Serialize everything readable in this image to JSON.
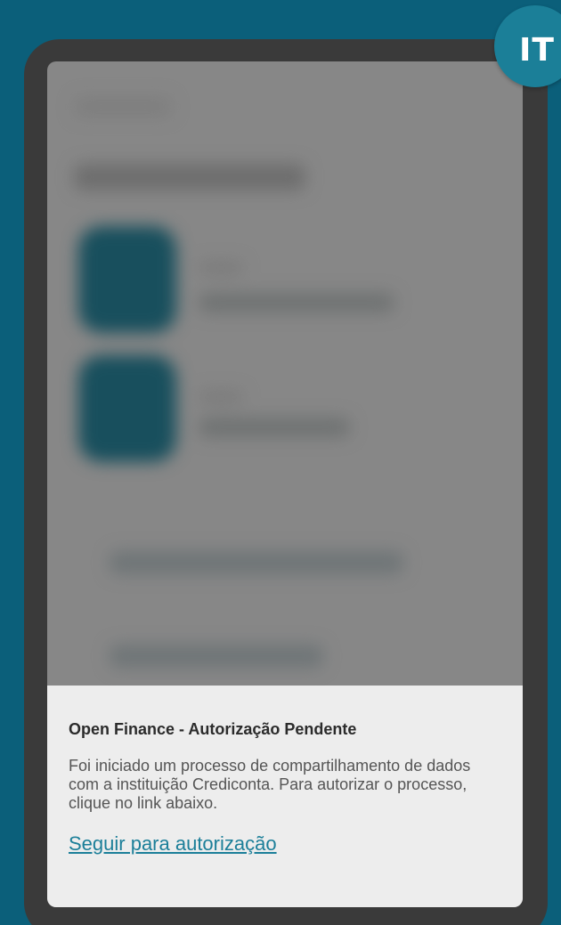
{
  "badge": {
    "label": "IT",
    "color": "#1b7f98"
  },
  "background_color": "#0b5f7a",
  "notification": {
    "title": "Open Finance - Autorização Pendente",
    "message": "Foi iniciado um processo de compartilhamento de dados com a instituição Crediconta. Para autorizar o processo, clique no link abaixo.",
    "link_label": "Seguir para autorização",
    "link_color": "#1c7f99"
  }
}
